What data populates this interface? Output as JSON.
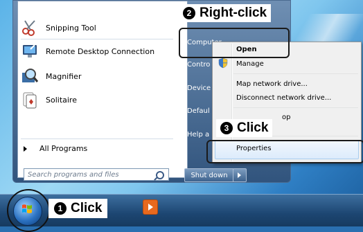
{
  "start_menu": {
    "programs": [
      {
        "label": "Snipping Tool",
        "icon": "scissors-icon"
      },
      {
        "label": "Remote Desktop Connection",
        "icon": "remote-desktop-icon"
      },
      {
        "label": "Magnifier",
        "icon": "magnifier-icon"
      },
      {
        "label": "Solitaire",
        "icon": "cards-icon"
      }
    ],
    "all_programs": "All Programs",
    "search_placeholder": "Search programs and files",
    "right_items": {
      "computer": "Computer",
      "control": "Contro",
      "devices": "Device",
      "default": "Defaul",
      "help": "Help a"
    },
    "shutdown": "Shut down"
  },
  "context_menu": {
    "open": "Open",
    "manage": "Manage",
    "map_drive": "Map network drive...",
    "disconnect_drive": "Disconnect network drive...",
    "show_desktop": "op",
    "properties": "Properties"
  },
  "callouts": {
    "step1_num": "1",
    "step1_text": "Click",
    "step2_num": "2",
    "step2_text": "Right-click",
    "step3_num": "3",
    "step3_text": "Click"
  }
}
